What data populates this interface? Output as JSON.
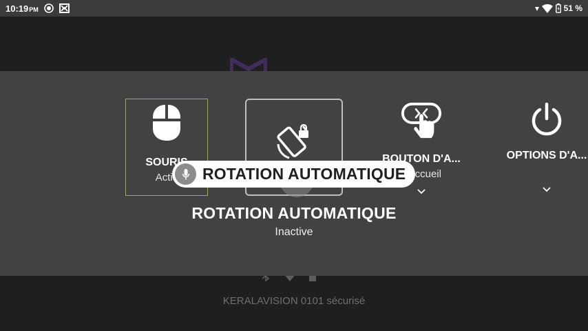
{
  "status_bar": {
    "time": "10:19",
    "ampm": "PM",
    "battery": "51 %"
  },
  "background": {
    "wifi_name": "KERALAVISION 0101 sécurisé"
  },
  "tiles": [
    {
      "label": "SOURIS",
      "sub": "Activ",
      "icon": "mouse-icon"
    },
    {
      "label": "",
      "sub": "",
      "icon": "rotate-lock-icon"
    },
    {
      "label": "BOUTON D'A...",
      "sub": "d'accueil",
      "icon": "touch-home-icon"
    },
    {
      "label": "OPTIONS D'A...",
      "sub": "",
      "icon": "power-icon"
    }
  ],
  "focused": {
    "title": "ROTATION AUTOMATIQUE",
    "state": "Inactive"
  },
  "voice_caption": {
    "text": "ROTATION AUTOMATIQUE",
    "icon": "mic-icon"
  },
  "colors": {
    "panel": "#424242",
    "focus_border": "#9ab52a",
    "status_bar": "#3b3b3b"
  }
}
